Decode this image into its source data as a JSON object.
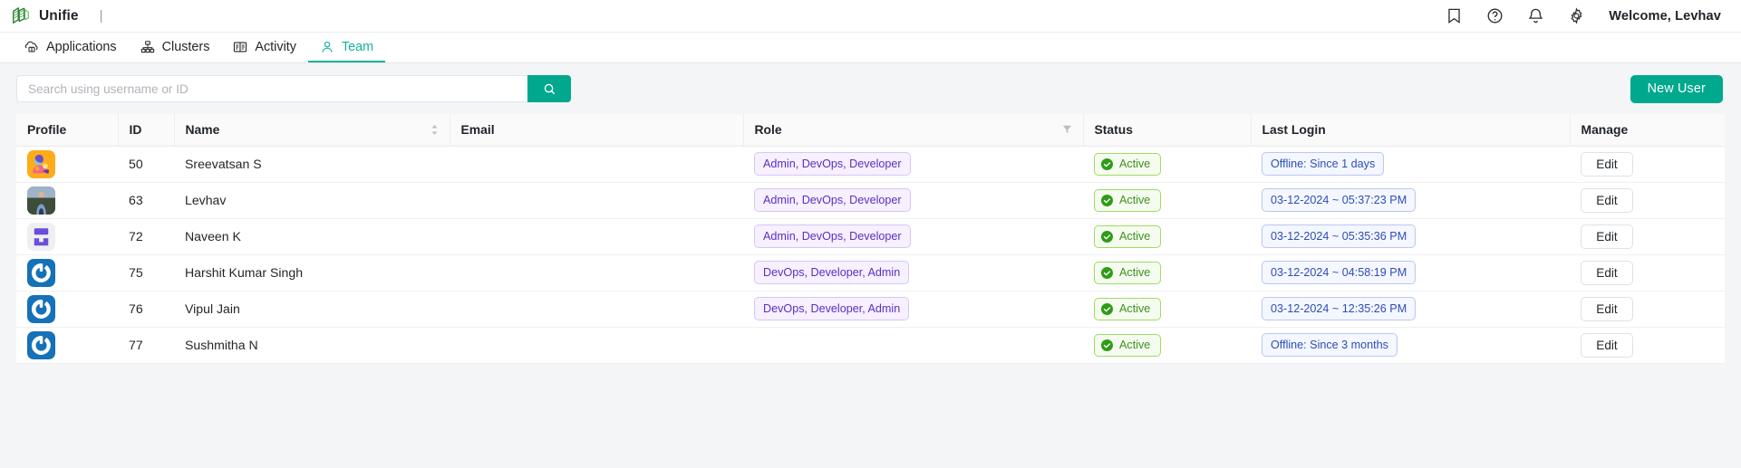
{
  "app": {
    "brand_name": "Unifie",
    "brand_separator": "|",
    "logo_icon": "unifie-layers-logo",
    "accent_color": "#00a88e",
    "active_tab_color": "#14b39a"
  },
  "topbar": {
    "icons": [
      {
        "name": "bookmark-icon",
        "label": "Bookmark"
      },
      {
        "name": "help-circle-icon",
        "label": "Help"
      },
      {
        "name": "bell-icon",
        "label": "Notifications"
      },
      {
        "name": "gear-icon",
        "label": "Settings"
      }
    ],
    "welcome_text": "Welcome, Levhav"
  },
  "tabs": [
    {
      "label": "Applications",
      "icon": "applications-icon",
      "active": false
    },
    {
      "label": "Clusters",
      "icon": "clusters-icon",
      "active": false
    },
    {
      "label": "Activity",
      "icon": "activity-icon",
      "active": false
    },
    {
      "label": "Team",
      "icon": "team-person-icon",
      "active": true
    }
  ],
  "toolbar": {
    "search_placeholder": "Search using username or ID",
    "search_value": "",
    "search_button_icon": "search-icon",
    "new_user_label": "New User"
  },
  "table": {
    "columns": [
      {
        "key": "profile",
        "label": "Profile"
      },
      {
        "key": "id",
        "label": "ID"
      },
      {
        "key": "name",
        "label": "Name",
        "sortable": true
      },
      {
        "key": "email",
        "label": "Email"
      },
      {
        "key": "role",
        "label": "Role",
        "filterable": true
      },
      {
        "key": "status",
        "label": "Status"
      },
      {
        "key": "last_login",
        "label": "Last Login"
      },
      {
        "key": "manage",
        "label": "Manage"
      }
    ],
    "edit_label": "Edit",
    "rows": [
      {
        "avatar": "avatar-illustration-orange",
        "id": "50",
        "name": "Sreevatsan S",
        "email": "",
        "role": "Admin, DevOps, Developer",
        "status": "Active",
        "last_login": "Offline: Since 1 days",
        "manage": "Edit"
      },
      {
        "avatar": "avatar-photo-person",
        "id": "63",
        "name": "Levhav",
        "email": "",
        "role": "Admin, DevOps, Developer",
        "status": "Active",
        "last_login": "03-12-2024 ~ 05:37:23 PM",
        "manage": "Edit"
      },
      {
        "avatar": "avatar-purple-blocks-logo",
        "id": "72",
        "name": "Naveen K",
        "email": "",
        "role": "Admin, DevOps, Developer",
        "status": "Active",
        "last_login": "03-12-2024 ~ 05:35:36 PM",
        "manage": "Edit"
      },
      {
        "avatar": "avatar-blue-power-logo",
        "id": "75",
        "name": "Harshit Kumar Singh",
        "email": "",
        "role": "DevOps, Developer, Admin",
        "status": "Active",
        "last_login": "03-12-2024 ~ 04:58:19 PM",
        "manage": "Edit"
      },
      {
        "avatar": "avatar-blue-power-logo",
        "id": "76",
        "name": "Vipul Jain",
        "email": "",
        "role": "DevOps, Developer, Admin",
        "status": "Active",
        "last_login": "03-12-2024 ~ 12:35:26 PM",
        "manage": "Edit"
      },
      {
        "avatar": "avatar-blue-power-logo",
        "id": "77",
        "name": "Sushmitha N",
        "email": "",
        "role": "",
        "status": "Active",
        "last_login": "Offline: Since 3 months",
        "manage": "Edit"
      }
    ]
  },
  "colors": {
    "role_badge_text": "#5b2ec4",
    "role_badge_bg": "#f6f0ff",
    "status_badge_text": "#3f8f20",
    "status_badge_bg": "#f5fcef",
    "login_badge_text": "#2d4db8",
    "login_badge_bg": "#f4f7ff"
  }
}
